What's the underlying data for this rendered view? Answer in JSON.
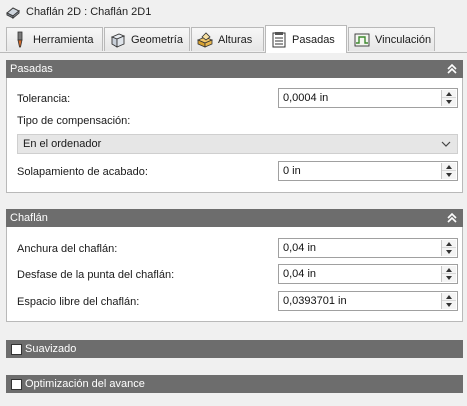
{
  "window": {
    "title": "Chaflán 2D : Chaflán 2D1"
  },
  "tabs": [
    {
      "label": "Herramienta",
      "icon": "tool-icon"
    },
    {
      "label": "Geometría",
      "icon": "geometry-icon"
    },
    {
      "label": "Alturas",
      "icon": "heights-icon"
    },
    {
      "label": "Pasadas",
      "icon": "passes-icon",
      "active": true
    },
    {
      "label": "Vinculación",
      "icon": "linking-icon"
    }
  ],
  "pasadas": {
    "header": "Pasadas",
    "tolerancia_label": "Tolerancia:",
    "tolerancia_value": "0,0004 in",
    "compensacion_label": "Tipo de compensación:",
    "compensacion_value": "En el ordenador",
    "solapamiento_label": "Solapamiento de acabado:",
    "solapamiento_value": "0 in"
  },
  "chaflan": {
    "header": "Chaflán",
    "anchura_label": "Anchura del chaflán:",
    "anchura_value": "0,04 in",
    "desfase_label": "Desfase de la punta del chaflán:",
    "desfase_value": "0,04 in",
    "espacio_label": "Espacio libre del chaflán:",
    "espacio_value": "0,0393701 in"
  },
  "suavizado": {
    "label": "Suavizado",
    "checked": false
  },
  "optimizacion": {
    "label": "Optimización del avance",
    "checked": false
  },
  "colors": {
    "section_header_bg": "#6d6d6d",
    "panel_bg": "#f0f0f0"
  }
}
